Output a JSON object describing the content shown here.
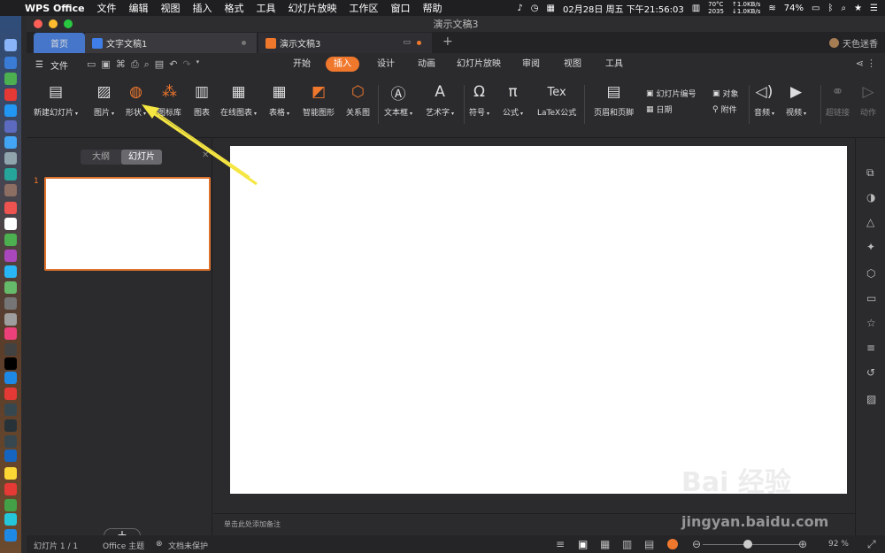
{
  "menubar": {
    "app_name": "WPS Office",
    "items": [
      "文件",
      "编辑",
      "视图",
      "插入",
      "格式",
      "工具",
      "幻灯片放映",
      "工作区",
      "窗口",
      "帮助"
    ],
    "datetime": "02月28日 周五 下午21:56:03",
    "temp": "70°C",
    "fan": "2035",
    "net_up": "↑1.0KB/s",
    "net_down": "↓1.0KB/s",
    "battery": "74%"
  },
  "window": {
    "title": "演示文稿3"
  },
  "tabs": {
    "home": "首页",
    "doc1": "文字文稿1",
    "doc2": "演示文稿3",
    "user": "天色迷香"
  },
  "menurow": {
    "file": "文件",
    "ribbon_tabs": [
      "开始",
      "插入",
      "设计",
      "动画",
      "幻灯片放映",
      "审阅",
      "视图",
      "工具"
    ],
    "active_tab": "插入"
  },
  "toolbar": {
    "new_slide": "新建幻灯片",
    "picture": "图片",
    "shape": "形状",
    "icon_lib": "图标库",
    "chart": "图表",
    "online_chart": "在线图表",
    "table": "表格",
    "smart_art": "智能图形",
    "relation": "关系图",
    "textbox": "文本框",
    "wordart": "艺术字",
    "symbol": "符号",
    "formula": "公式",
    "latex": "LaTeX公式",
    "latex_icon": "Tex",
    "header_footer": "页眉和页脚",
    "slide_number": "幻灯片编号",
    "date": "日期",
    "object": "对象",
    "attachment": "附件",
    "audio": "音频",
    "video": "视频",
    "hyperlink": "超链接",
    "action": "动作"
  },
  "sidebar": {
    "outline": "大纲",
    "slides": "幻灯片",
    "slide_index": "1"
  },
  "notes": {
    "placeholder": "单击此处添加备注"
  },
  "status": {
    "slide_count": "幻灯片 1 / 1",
    "theme": "Office 主题",
    "protect": "文档未保护",
    "zoom": "92 %"
  },
  "watermark": {
    "logo": "Bai 经验",
    "url": "jingyan.baidu.com"
  },
  "colors": {
    "accent": "#f0782d",
    "home_tab": "#4676c9",
    "arrow": "#f5e642"
  }
}
